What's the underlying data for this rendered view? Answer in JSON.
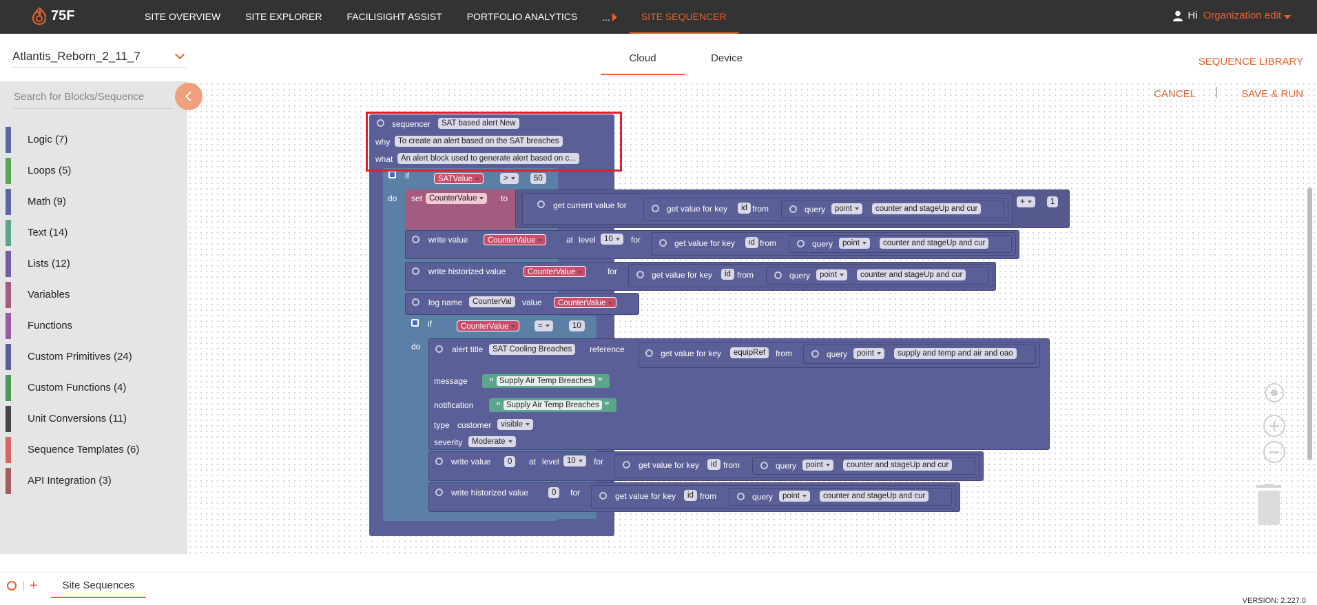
{
  "topbar": {
    "logo_text": "75F",
    "nav": [
      "SITE OVERVIEW",
      "SITE EXPLORER",
      "FACILISIGHT ASSIST",
      "PORTFOLIO ANALYTICS"
    ],
    "more_label": "...",
    "active_nav": "SITE SEQUENCER",
    "greeting": "Hi",
    "org_label": "Organization edit"
  },
  "site": {
    "name": "Atlantis_Reborn_2_11_7"
  },
  "tabs": [
    "Cloud",
    "Device"
  ],
  "sequence_library": "SEQUENCE LIBRARY",
  "actions": {
    "cancel": "CANCEL",
    "save_run": "SAVE & RUN"
  },
  "sidebar": {
    "search_placeholder": "Search for Blocks/Sequence",
    "categories": [
      {
        "label": "Logic (7)",
        "color": "#5b67a5"
      },
      {
        "label": "Loops (5)",
        "color": "#5ba55b"
      },
      {
        "label": "Math (9)",
        "color": "#5b67a5"
      },
      {
        "label": "Text (14)",
        "color": "#5ba58c"
      },
      {
        "label": "Lists (12)",
        "color": "#745ba5"
      },
      {
        "label": "Variables",
        "color": "#a55b80"
      },
      {
        "label": "Functions",
        "color": "#995ba5"
      },
      {
        "label": "Custom Primitives (24)",
        "color": "#5b5f97"
      },
      {
        "label": "Custom Functions (4)",
        "color": "#4a9a55"
      },
      {
        "label": "Unit Conversions (11)",
        "color": "#444444"
      },
      {
        "label": "Sequence Templates (6)",
        "color": "#d66565"
      },
      {
        "label": "API Integration (3)",
        "color": "#a55b5b"
      }
    ]
  },
  "blocks": {
    "sequencer_kw": "sequencer",
    "sequencer_name": "SAT based alert New",
    "why_kw": "why",
    "why_text": "To create an alert based on the SAT breaches",
    "what_kw": "what",
    "what_text": "An alert block used to generate alert based on c...",
    "if_kw": "if",
    "do_kw": "do",
    "satvalue": "SATValue",
    "gt": ">",
    "fifty": "50",
    "set_kw": "set",
    "counter_var": "CounterValue",
    "to_kw": "to",
    "get_current": "get current value for",
    "get_value_key": "get value for key",
    "id_kw": "id",
    "from_kw": "from",
    "query_kw": "query",
    "point_kw": "point",
    "counter_filter": "counter and stageUp and cur",
    "plus": "+",
    "one": "1",
    "write_value": "write value",
    "at_kw": "at",
    "level_kw": "level",
    "ten": "10",
    "for_kw": "for",
    "write_hist": "write historized value",
    "log_name": "log name",
    "counterval_name": "CounterVal",
    "value_kw": "value",
    "eq": "=",
    "alert_title": "alert title",
    "alert_name": "SAT Cooling Breaches",
    "reference_kw": "reference",
    "equipref": "equipRef",
    "supply_filter": "supply and temp and air and oao",
    "message_kw": "message",
    "message_text": "Supply Air Temp Breaches",
    "notification_kw": "notification",
    "notification_text": "Supply Air Temp Breaches",
    "type_kw": "type",
    "customer_kw": "customer",
    "visible": "visible",
    "severity_kw": "severity",
    "moderate": "Moderate",
    "zero": "0",
    "open_quote": "“",
    "close_quote": "”"
  },
  "bottom": {
    "tab": "Site Sequences",
    "plus": "+"
  },
  "version": "VERSION: 2.227.0"
}
